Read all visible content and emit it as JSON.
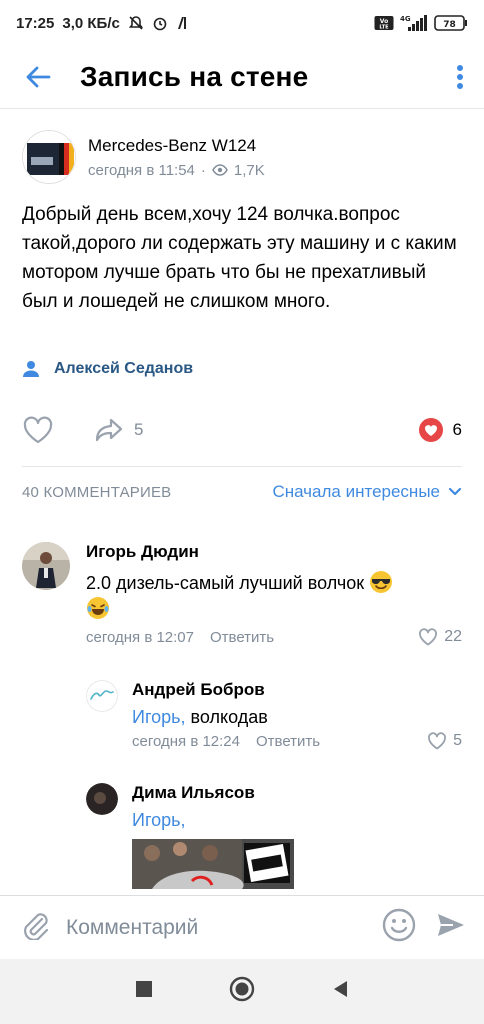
{
  "status": {
    "time": "17:25",
    "speed": "3,0 КБ/с",
    "network": "4G",
    "battery": "78"
  },
  "header": {
    "title": "Запись на стене"
  },
  "post": {
    "group_name": "Mercedes-Benz W124",
    "time": "сегодня в 11:54",
    "views": "1,7K",
    "text": "Добрый день всем,хочу 124 волчка.вопрос такой,дорого ли содержать эту машину и с каким мотором лучше брать что бы не прехатливый был и лошедей не слишком много.",
    "author": "Алексей Седанов",
    "shares": "5",
    "likes": "6"
  },
  "comments_header": {
    "count_label": "40 КОММЕНТАРИЕВ",
    "sort_label": "Сначала интересные"
  },
  "comments": [
    {
      "name": "Игорь Дюдин",
      "text": "2.0 дизель-самый лучший волчок",
      "time": "сегодня в 12:07",
      "reply": "Ответить",
      "likes": "22"
    },
    {
      "name": "Андрей Бобров",
      "mention": "Игорь,",
      "text": " волкодав",
      "time": "сегодня в 12:24",
      "reply": "Ответить",
      "likes": "5"
    },
    {
      "name": "Дима Ильясов",
      "mention": "Игорь,"
    }
  ],
  "composer": {
    "placeholder": "Комментарий"
  },
  "colors": {
    "accent": "#3f8ae0",
    "secondary_text": "#818c99",
    "like_red": "#e64646"
  }
}
